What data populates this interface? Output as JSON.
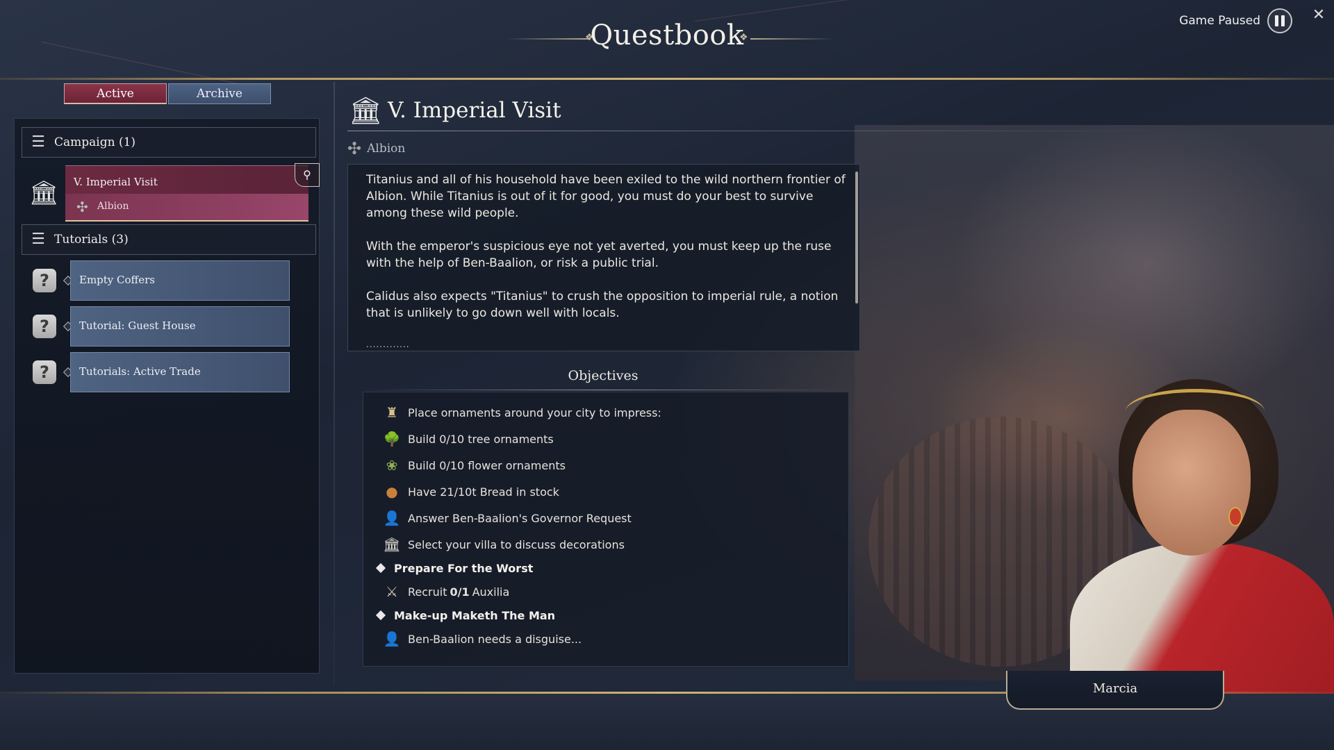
{
  "header": {
    "title": "Questbook",
    "pause_label": "Game Paused"
  },
  "tabs": [
    {
      "label": "Active"
    },
    {
      "label": "Archive"
    }
  ],
  "groups": {
    "campaign": {
      "label": "Campaign (1)",
      "icon": "scroll-icon"
    },
    "tutorials": {
      "label": "Tutorials (3)",
      "icon": "scroll-icon"
    }
  },
  "campaign_quests": [
    {
      "name": "V. Imperial Visit",
      "region": "Albion",
      "icon": "temple-icon",
      "selected": true
    }
  ],
  "tutorial_quests": [
    {
      "name": "Empty Coffers",
      "icon": "question-icon"
    },
    {
      "name": "Tutorial: Guest House",
      "icon": "question-icon"
    },
    {
      "name": "Tutorials: Active Trade",
      "icon": "question-icon"
    }
  ],
  "detail": {
    "title": "V. Imperial Visit",
    "region": "Albion",
    "description": [
      "Titanius and all of his household have been exiled to the wild northern frontier of Albion. While Titanius is out of it for good, you must do your best to survive among these wild people.",
      "With the emperor's suspicious eye not yet averted, you must keep up the ruse with the help of Ben-Baalion, or risk a public trial.",
      "Calidus also expects \"Titanius\" to crush the opposition to imperial rule, a notion that is unlikely to go down well with locals."
    ],
    "description_more": ".............",
    "objectives_title": "Objectives",
    "objectives": {
      "group1_text": "Place ornaments around your city to impress:",
      "tree": "Build 0/10 tree ornaments",
      "flower": "Build 0/10 flower ornaments",
      "bread": "Have 21/10t Bread in stock",
      "governor": "Answer Ben-Baalion's Governor Request",
      "villa": "Select your villa to discuss decorations",
      "header2": "Prepare For the Worst",
      "recruit_prefix": "Recruit",
      "recruit_count": "0/1",
      "recruit_suffix": "Auxilia",
      "header3": "Make-up Maketh The Man",
      "disguise": "Ben-Baalion needs a disguise..."
    }
  },
  "character": {
    "name": "Marcia"
  },
  "colors": {
    "accent_active": "#7b3450",
    "tab_inactive": "#4d6283",
    "gold": "#cdb27a"
  }
}
